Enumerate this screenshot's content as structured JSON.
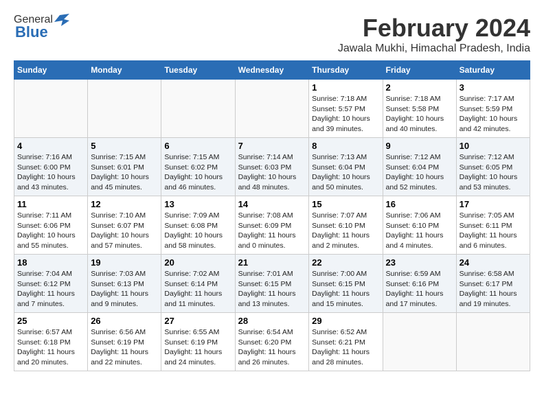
{
  "header": {
    "logo_general": "General",
    "logo_blue": "Blue",
    "month_title": "February 2024",
    "location": "Jawala Mukhi, Himachal Pradesh, India"
  },
  "days_of_week": [
    "Sunday",
    "Monday",
    "Tuesday",
    "Wednesday",
    "Thursday",
    "Friday",
    "Saturday"
  ],
  "weeks": [
    [
      {
        "day": "",
        "info": ""
      },
      {
        "day": "",
        "info": ""
      },
      {
        "day": "",
        "info": ""
      },
      {
        "day": "",
        "info": ""
      },
      {
        "day": "1",
        "info": "Sunrise: 7:18 AM\nSunset: 5:57 PM\nDaylight: 10 hours\nand 39 minutes."
      },
      {
        "day": "2",
        "info": "Sunrise: 7:18 AM\nSunset: 5:58 PM\nDaylight: 10 hours\nand 40 minutes."
      },
      {
        "day": "3",
        "info": "Sunrise: 7:17 AM\nSunset: 5:59 PM\nDaylight: 10 hours\nand 42 minutes."
      }
    ],
    [
      {
        "day": "4",
        "info": "Sunrise: 7:16 AM\nSunset: 6:00 PM\nDaylight: 10 hours\nand 43 minutes."
      },
      {
        "day": "5",
        "info": "Sunrise: 7:15 AM\nSunset: 6:01 PM\nDaylight: 10 hours\nand 45 minutes."
      },
      {
        "day": "6",
        "info": "Sunrise: 7:15 AM\nSunset: 6:02 PM\nDaylight: 10 hours\nand 46 minutes."
      },
      {
        "day": "7",
        "info": "Sunrise: 7:14 AM\nSunset: 6:03 PM\nDaylight: 10 hours\nand 48 minutes."
      },
      {
        "day": "8",
        "info": "Sunrise: 7:13 AM\nSunset: 6:04 PM\nDaylight: 10 hours\nand 50 minutes."
      },
      {
        "day": "9",
        "info": "Sunrise: 7:12 AM\nSunset: 6:04 PM\nDaylight: 10 hours\nand 52 minutes."
      },
      {
        "day": "10",
        "info": "Sunrise: 7:12 AM\nSunset: 6:05 PM\nDaylight: 10 hours\nand 53 minutes."
      }
    ],
    [
      {
        "day": "11",
        "info": "Sunrise: 7:11 AM\nSunset: 6:06 PM\nDaylight: 10 hours\nand 55 minutes."
      },
      {
        "day": "12",
        "info": "Sunrise: 7:10 AM\nSunset: 6:07 PM\nDaylight: 10 hours\nand 57 minutes."
      },
      {
        "day": "13",
        "info": "Sunrise: 7:09 AM\nSunset: 6:08 PM\nDaylight: 10 hours\nand 58 minutes."
      },
      {
        "day": "14",
        "info": "Sunrise: 7:08 AM\nSunset: 6:09 PM\nDaylight: 11 hours\nand 0 minutes."
      },
      {
        "day": "15",
        "info": "Sunrise: 7:07 AM\nSunset: 6:10 PM\nDaylight: 11 hours\nand 2 minutes."
      },
      {
        "day": "16",
        "info": "Sunrise: 7:06 AM\nSunset: 6:10 PM\nDaylight: 11 hours\nand 4 minutes."
      },
      {
        "day": "17",
        "info": "Sunrise: 7:05 AM\nSunset: 6:11 PM\nDaylight: 11 hours\nand 6 minutes."
      }
    ],
    [
      {
        "day": "18",
        "info": "Sunrise: 7:04 AM\nSunset: 6:12 PM\nDaylight: 11 hours\nand 7 minutes."
      },
      {
        "day": "19",
        "info": "Sunrise: 7:03 AM\nSunset: 6:13 PM\nDaylight: 11 hours\nand 9 minutes."
      },
      {
        "day": "20",
        "info": "Sunrise: 7:02 AM\nSunset: 6:14 PM\nDaylight: 11 hours\nand 11 minutes."
      },
      {
        "day": "21",
        "info": "Sunrise: 7:01 AM\nSunset: 6:15 PM\nDaylight: 11 hours\nand 13 minutes."
      },
      {
        "day": "22",
        "info": "Sunrise: 7:00 AM\nSunset: 6:15 PM\nDaylight: 11 hours\nand 15 minutes."
      },
      {
        "day": "23",
        "info": "Sunrise: 6:59 AM\nSunset: 6:16 PM\nDaylight: 11 hours\nand 17 minutes."
      },
      {
        "day": "24",
        "info": "Sunrise: 6:58 AM\nSunset: 6:17 PM\nDaylight: 11 hours\nand 19 minutes."
      }
    ],
    [
      {
        "day": "25",
        "info": "Sunrise: 6:57 AM\nSunset: 6:18 PM\nDaylight: 11 hours\nand 20 minutes."
      },
      {
        "day": "26",
        "info": "Sunrise: 6:56 AM\nSunset: 6:19 PM\nDaylight: 11 hours\nand 22 minutes."
      },
      {
        "day": "27",
        "info": "Sunrise: 6:55 AM\nSunset: 6:19 PM\nDaylight: 11 hours\nand 24 minutes."
      },
      {
        "day": "28",
        "info": "Sunrise: 6:54 AM\nSunset: 6:20 PM\nDaylight: 11 hours\nand 26 minutes."
      },
      {
        "day": "29",
        "info": "Sunrise: 6:52 AM\nSunset: 6:21 PM\nDaylight: 11 hours\nand 28 minutes."
      },
      {
        "day": "",
        "info": ""
      },
      {
        "day": "",
        "info": ""
      }
    ]
  ]
}
